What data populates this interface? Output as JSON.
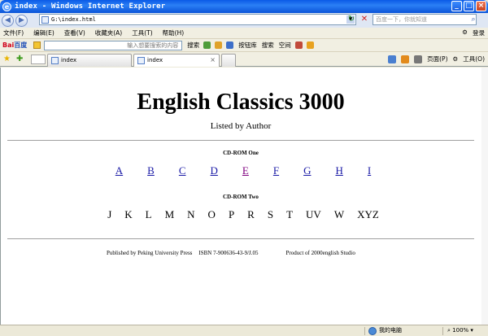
{
  "window": {
    "title": "index - Windows Internet Explorer"
  },
  "address": {
    "url": "G:\\index.html",
    "search_placeholder": "百度一下，你就知道"
  },
  "menu": {
    "items": [
      "文件(F)",
      "编辑(E)",
      "查看(V)",
      "收藏夹(A)",
      "工具(T)",
      "帮助(H)"
    ],
    "right_login": "登录"
  },
  "baidu_toolbar": {
    "logo_left": "Bai",
    "logo_right": "百度",
    "search_placeholder": "输入想要搜索的内容",
    "search_label": "搜索",
    "other1": "按钮库",
    "other2": "搜索",
    "other3": "空间"
  },
  "tabs": [
    {
      "label": "index"
    },
    {
      "label": "index"
    }
  ],
  "command_bar": {
    "page_label": "页面(P)",
    "tools_label": "工具(O)"
  },
  "page": {
    "title": "English Classics 3000",
    "subtitle": "Listed by Author",
    "cd_one_heading": "CD-ROM One",
    "cd_one_letters": [
      "A",
      "B",
      "C",
      "D",
      "E",
      "F",
      "G",
      "H",
      "I"
    ],
    "cd_two_heading": "CD-ROM Two",
    "cd_two_letters": [
      "J",
      "K",
      "L",
      "M",
      "N",
      "O",
      "P",
      "R",
      "S",
      "T",
      "UV",
      "W",
      "XYZ"
    ],
    "publisher": "Published by Peking University Press",
    "isbn": "ISBN 7-900636-43-9/J.05",
    "product": "Product of 2000english Studio"
  },
  "status": {
    "zone": "我的电脑",
    "zoom": "100%"
  }
}
